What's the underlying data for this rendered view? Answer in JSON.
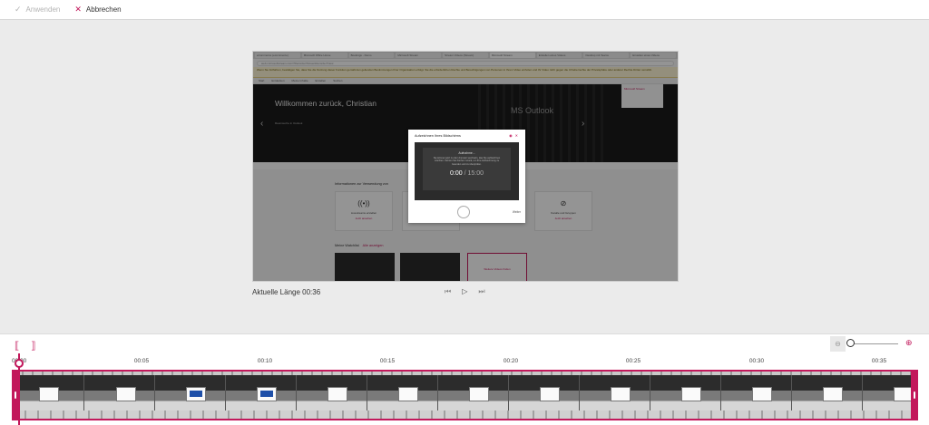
{
  "toolbar": {
    "apply_label": "Anwenden",
    "cancel_label": "Abbrechen"
  },
  "preview": {
    "browser_tabs": [
      "eCommerce (ecommerce)",
      "Microsoft Office Home",
      "Bookings - Demo",
      "Microsoft Stream",
      "Stream Videos (Stream)",
      "Microsoft Stream",
      "Erstellen eines Videos",
      "Desktop mit Teams",
      "Erstellen eines Videos"
    ],
    "address": "web.microsoftstream.com/?Recorder/ScreenRecorder?view",
    "warning": "Wenn Sie fortfahren, bestätigen Sie, dass Sie die Nutzung dieser Funktion gemäß den geltenden Bestimmungen Ihrer Organisation erfolgt. Sie die erforderlichen Rechte und Berechtigungen von Personen in Ihrem Video einholen und Ihr Video nicht gegen die Urheberrechte der Privatsphäre oder anderer Rechte Dritter verstößt.",
    "appnav": [
      "Start",
      "Entdecken",
      "Meine Inhalte",
      "Erstellen",
      "Suchen"
    ],
    "hero_title": "Willkommen zurück, Christian",
    "hero_subtitle": "MS Outlook",
    "hero_tag": "",
    "hero_card_text": "Raumsuche in Outlook",
    "hero_thumb_text": "Microsoft Stream",
    "info_title": "Informationen zur Verwendung von",
    "info_cards": [
      {
        "label": "Livestreams erstellen",
        "link": "Jetzt ansehen"
      },
      {
        "label": "Gruppen",
        "link": "Jetzt ansehen"
      },
      {
        "label": "Kanäle und Gruppen",
        "link": "Jetzt ansehen"
      }
    ],
    "watchlist_title": "Meine Watchlist",
    "watchlist_link": "Alle anzeigen",
    "watchlist_add": "Weitere Videos finden",
    "dialog": {
      "title": "Aufzeichnen Ihres Bildschirms",
      "recording": "Aufnahme...",
      "message": "Sie können jetzt zu dem Fenster wechseln, das Sie aufzeichnen möchten. Kehren Sie hierher zurück, um Ihre Aufzeichnung zu beenden und zu überprüfen.",
      "time_current": "0:00",
      "time_separator": " / ",
      "time_total": "15:00",
      "next_label": "Weiter"
    }
  },
  "status": {
    "current_length": "Aktuelle Länge 00:36"
  },
  "controls": {
    "prev_icon": "skip-previous-icon",
    "play_icon": "play-icon",
    "next_icon": "skip-next-icon"
  },
  "timeline": {
    "labels": [
      "00:00",
      "00:05",
      "00:10",
      "00:15",
      "00:20",
      "00:25",
      "00:30",
      "00:35"
    ],
    "zoom_out_icon": "zoom-out-icon",
    "zoom_in_icon": "zoom-in-icon",
    "trim_start_icon": "trim-start-icon",
    "trim_end_icon": "trim-end-icon",
    "playhead_time": "00:00"
  },
  "colors": {
    "accent": "#c2185b",
    "background": "#ebebeb",
    "toolbar": "#ffffff"
  }
}
